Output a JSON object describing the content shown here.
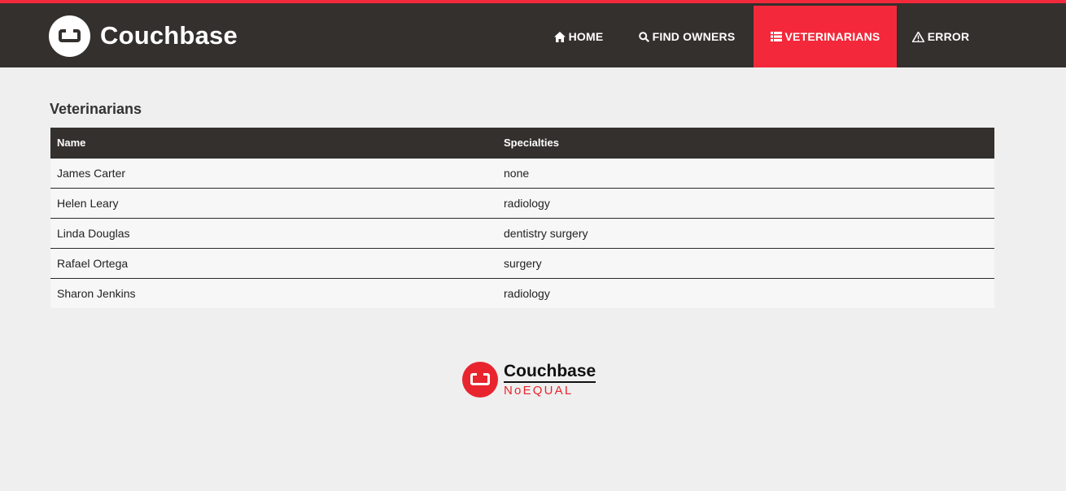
{
  "header": {
    "brand": "Couchbase",
    "nav": [
      {
        "label": "HOME",
        "icon": "home-icon"
      },
      {
        "label": "FIND OWNERS",
        "icon": "search-icon"
      },
      {
        "label": "VETERINARIANS",
        "icon": "list-icon",
        "active": true
      },
      {
        "label": "ERROR",
        "icon": "warning-icon"
      }
    ]
  },
  "colors": {
    "header_bg": "#34302d",
    "accent": "#f3283a",
    "page_bg": "#efefef"
  },
  "main": {
    "title": "Veterinarians",
    "table": {
      "columns": [
        "Name",
        "Specialties"
      ],
      "rows": [
        [
          "James Carter",
          "none"
        ],
        [
          "Helen Leary",
          "radiology"
        ],
        [
          "Linda Douglas",
          "dentistry surgery"
        ],
        [
          "Rafael Ortega",
          "surgery"
        ],
        [
          "Sharon Jenkins",
          "radiology"
        ]
      ]
    }
  },
  "footer": {
    "brand": "Couchbase",
    "tagline": "NoEQUAL"
  }
}
